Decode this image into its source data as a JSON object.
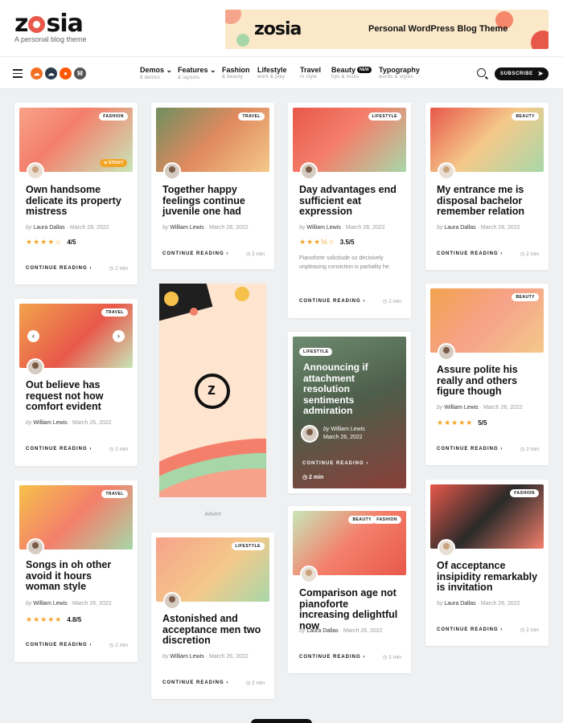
{
  "site": {
    "logo": "zosia",
    "tagline": "A personal blog theme"
  },
  "banner": {
    "logo": "zosia",
    "text": "Personal WordPress Blog Theme"
  },
  "nav": {
    "social": [
      "soundcloud",
      "cloud",
      "reddit",
      "medium"
    ],
    "items": [
      {
        "label": "Demos",
        "sub": "8 demos",
        "arrow": "⌄"
      },
      {
        "label": "Features",
        "sub": "& layouts",
        "arrow": "⌄"
      },
      {
        "label": "Fashion",
        "sub": "& beauty",
        "arrow": ""
      },
      {
        "label": "Lifestyle",
        "sub": "work & play",
        "arrow": ""
      },
      {
        "label": "Travel",
        "sub": "in style",
        "arrow": ""
      },
      {
        "label": "Beauty",
        "sub": "tips & tricks",
        "badge": "NEW",
        "arrow": ""
      },
      {
        "label": "Typography",
        "sub": "words & styles",
        "arrow": ""
      }
    ],
    "subscribe": "SUBSCRIBE"
  },
  "common": {
    "continue": "CONTINUE READING ›",
    "by": "by",
    "read_time": "◷ 2 min",
    "sticky": "★ STICKY",
    "advert": "Advert"
  },
  "posts": [
    {
      "category": "FASHION",
      "title": "Own handsome delicate its property mistress",
      "author": "Laura Dallas",
      "date": "March 28, 2022",
      "rating": "4/5",
      "stars": "★★★★☆"
    },
    {
      "category": "TRAVEL",
      "title": "Together happy feelings continue juvenile one had",
      "author": "William Lewis",
      "date": "March 28, 2022"
    },
    {
      "category": "LIFESTYLE",
      "title": "Day advantages end sufficient eat expression",
      "author": "William Lewis",
      "date": "March 28, 2022",
      "rating": "3.5/5",
      "stars": "★★★½☆",
      "excerpt": "Pianoforte solicitude so decisively unpleasing conviction is partiality he."
    },
    {
      "category": "BEAUTY",
      "title": "My entrance me is disposal bachelor remember relation",
      "author": "Laura Dallas",
      "date": "March 28, 2022"
    },
    {
      "category": "TRAVEL",
      "title": "Out believe has request not how comfort evident",
      "author": "William Lewis",
      "date": "March 26, 2022"
    },
    {
      "category": "LIFESTYLE",
      "title": "Announcing if attachment resolution sentiments admiration",
      "author": "William Lewis",
      "date": "March 26, 2022"
    },
    {
      "category": "BEAUTY",
      "title": "Assure polite his really and others figure though",
      "author": "William Lewis",
      "date": "March 28, 2022",
      "rating": "5/5",
      "stars": "★★★★★"
    },
    {
      "category": "TRAVEL",
      "title": "Songs in oh other avoid it hours woman style",
      "author": "William Lewis",
      "date": "March 26, 2022",
      "rating": "4.8/5",
      "stars": "★★★★★"
    },
    {
      "category": "LIFESTYLE",
      "title": "Astonished and acceptance men two discretion",
      "author": "William Lewis",
      "date": "March 26, 2022"
    },
    {
      "category": "BEAUTY",
      "category2": "FASHION",
      "title": "Comparison age not pianoforte increasing delightful now",
      "author": "Laura Dallas",
      "date": "March 26, 2022"
    },
    {
      "category": "FASHION",
      "title": "Of acceptance insipidity remarkably is invitation",
      "author": "Laura Dallas",
      "date": "March 26, 2022"
    }
  ],
  "colors": {
    "accent": "#e8584a",
    "star": "#f2a524",
    "ink": "#111111",
    "background": "#eef0f2"
  }
}
